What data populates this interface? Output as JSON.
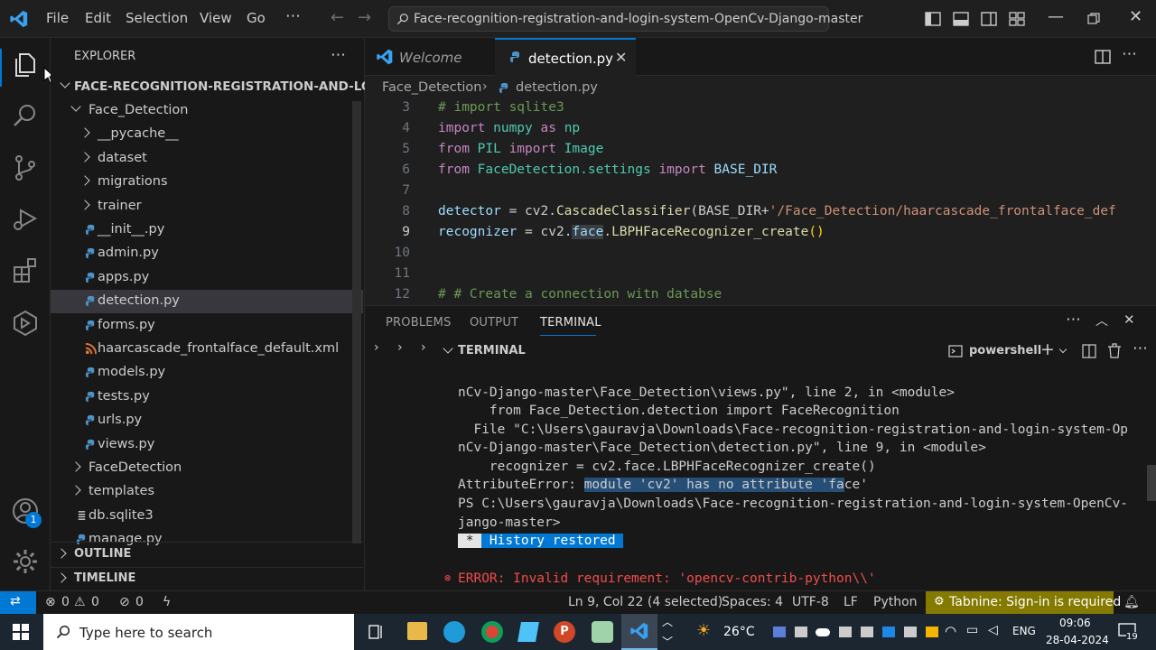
{
  "menu": [
    "File",
    "Edit",
    "Selection",
    "View",
    "Go",
    "⋯"
  ],
  "search_text": "Face-recognition-registration-and-login-system-OpenCv-Django-master",
  "explorer": {
    "title": "EXPLORER",
    "root": "FACE-RECOGNITION-REGISTRATION-AND-LOGIN...",
    "items": [
      {
        "label": "Face_Detection",
        "type": "folder-open"
      },
      {
        "label": "__pycache__",
        "type": "folder"
      },
      {
        "label": "dataset",
        "type": "folder"
      },
      {
        "label": "migrations",
        "type": "folder"
      },
      {
        "label": "trainer",
        "type": "folder"
      },
      {
        "label": "__init__.py",
        "type": "py"
      },
      {
        "label": "admin.py",
        "type": "py"
      },
      {
        "label": "apps.py",
        "type": "py"
      },
      {
        "label": "detection.py",
        "type": "py"
      },
      {
        "label": "forms.py",
        "type": "py"
      },
      {
        "label": "haarcascade_frontalface_default.xml",
        "type": "xml"
      },
      {
        "label": "models.py",
        "type": "py"
      },
      {
        "label": "tests.py",
        "type": "py"
      },
      {
        "label": "urls.py",
        "type": "py"
      },
      {
        "label": "views.py",
        "type": "py"
      },
      {
        "label": "FaceDetection",
        "type": "folder"
      },
      {
        "label": "templates",
        "type": "folder"
      },
      {
        "label": "db.sqlite3",
        "type": "db"
      },
      {
        "label": "manage.py",
        "type": "py"
      }
    ],
    "outline": "OUTLINE",
    "timeline": "TIMELINE"
  },
  "tabs": {
    "welcome": "Welcome",
    "active": "detection.py"
  },
  "breadcrumb": {
    "folder": "Face_Detection",
    "file": "detection.py"
  },
  "code": {
    "l3": "3",
    "l4": "4",
    "l5": "5",
    "l6": "6",
    "l7": "7",
    "l8": "8",
    "l9": "9",
    "l10": "10",
    "l11": "11",
    "l12": "12",
    "c3": "# import sqlite3",
    "c4_kw1": "import",
    "c4_mod": " numpy ",
    "c4_kw2": "as",
    "c4_alias": " np",
    "c5_kw1": "from",
    "c5_mod": " PIL ",
    "c5_kw2": "import",
    "c5_cls": " Image",
    "c6_kw1": "from",
    "c6_mod": " FaceDetection.settings ",
    "c6_kw2": "import",
    "c6_name": " BASE_DIR",
    "c8_var": "detector",
    "c8_eq": " = cv2.",
    "c8_fn": "CascadeClassifier",
    "c8_open": "(BASE_DIR+",
    "c8_str": "'/Face_Detection/haarcascade_frontalface_def",
    "c9_var": "recognizer",
    "c9_eq": " = cv2.",
    "c9_sel": "face",
    "c9_dot": ".",
    "c9_fn": "LBPHFaceRecognizer_create",
    "c9_paren": "()",
    "c12": "# # Create a connection witn databse"
  },
  "panel": {
    "tabs": [
      "PROBLEMS",
      "OUTPUT",
      "TERMINAL"
    ],
    "section": "TERMINAL",
    "shell": "powershell"
  },
  "terminal": [
    "nCv-Django-master\\Face_Detection\\views.py\", line 2, in <module>",
    "    from Face_Detection.detection import FaceRecognition",
    "  File \"C:\\Users\\gauravja\\Downloads\\Face-recognition-registration-and-login-system-Op",
    "nCv-Django-master\\Face_Detection\\detection.py\", line 9, in <module>",
    "    recognizer = cv2.face.LBPHFaceRecognizer_create()"
  ],
  "error_prefix": "AttributeError: ",
  "error_highlight": "module 'cv2' has no attribute 'fa",
  "error_tail": "ce'",
  "prompt1": "PS C:\\Users\\gauravja\\Downloads\\Face-recognition-registration-and-login-system-OpenCv-",
  "prompt2": "jango-master>",
  "history_star": " * ",
  "history_text": " History restored ",
  "error_line": "ERROR: Invalid requirement: 'opencv-contrib-python\\\\'",
  "status": {
    "errors": "0",
    "warnings": "0",
    "ports": "0",
    "position": "Ln 9, Col 22 (4 selected)",
    "spaces": "Spaces: 4",
    "encoding": "UTF-8",
    "eol": "LF",
    "language": "Python",
    "tabnine": "Tabnine: Sign-in is required"
  },
  "taskbar": {
    "search": "Type here to search",
    "weather": "26°C",
    "lang": "ENG",
    "time": "09:06",
    "date": "28-04-2024",
    "notif_count": "19"
  },
  "account_badge": "1",
  "colors": {
    "accent": "#0078d4",
    "tabnine": "#847a00",
    "selection": "#264f78"
  }
}
